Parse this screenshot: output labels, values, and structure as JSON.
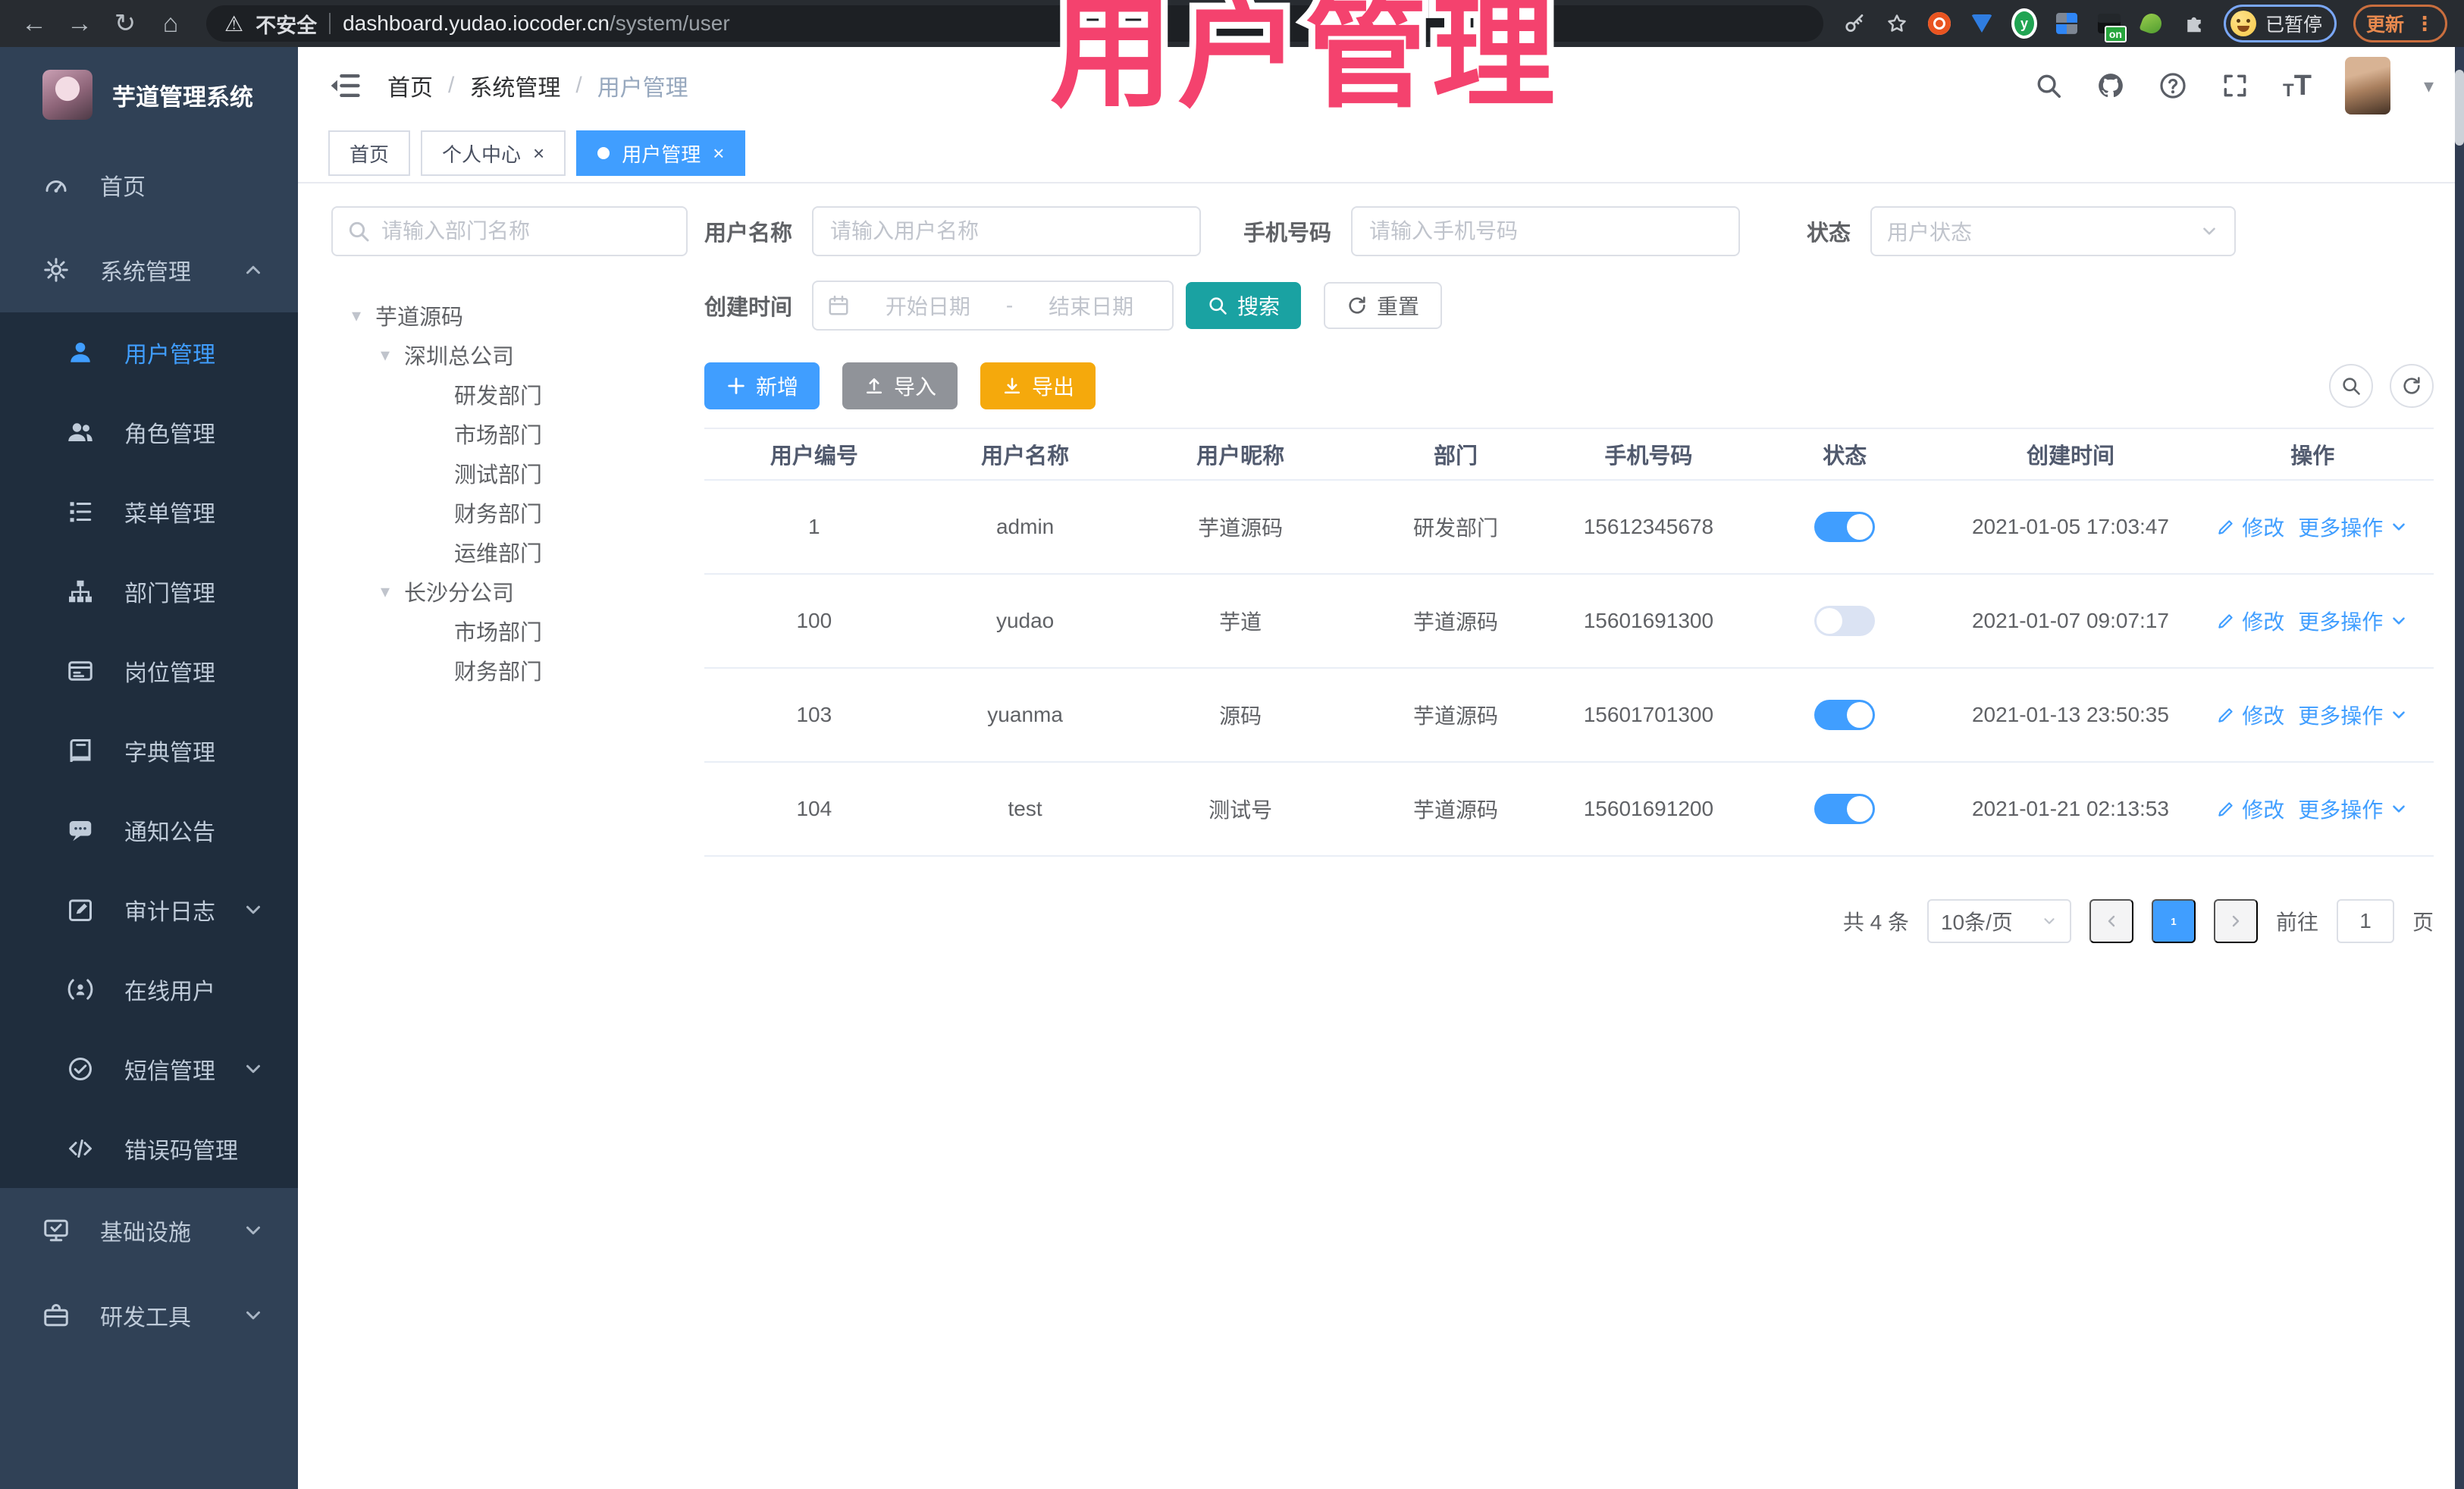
{
  "browser": {
    "security_label": "不安全",
    "url_host": "dashboard.yudao.iocoder.cn",
    "url_path": "/system/user",
    "profile_status": "已暂停",
    "update_label": "更新",
    "extension_badge": "on"
  },
  "overlay_title": "用户管理",
  "icons": {
    "close": "×",
    "caret_down": "▾",
    "dots_vertical": "⋮",
    "back": "←",
    "forward": "→",
    "reload": "↻",
    "home": "⌂",
    "warning": "⚠",
    "tree_caret": "▾"
  },
  "sidebar": {
    "title": "芋道管理系统",
    "items": [
      {
        "icon": "gauge",
        "label": "首页",
        "level": 1
      },
      {
        "icon": "gear",
        "label": "系统管理",
        "level": 1,
        "chevron": "up"
      },
      {
        "icon": "user",
        "label": "用户管理",
        "level": 2,
        "active": true
      },
      {
        "icon": "users",
        "label": "角色管理",
        "level": 2
      },
      {
        "icon": "list",
        "label": "菜单管理",
        "level": 2
      },
      {
        "icon": "tree",
        "label": "部门管理",
        "level": 2
      },
      {
        "icon": "idcard",
        "label": "岗位管理",
        "level": 2
      },
      {
        "icon": "book",
        "label": "字典管理",
        "level": 2
      },
      {
        "icon": "chat",
        "label": "通知公告",
        "level": 2
      },
      {
        "icon": "editpad",
        "label": "审计日志",
        "level": 2,
        "chevron": "down"
      },
      {
        "icon": "online",
        "label": "在线用户",
        "level": 2
      },
      {
        "icon": "checkcircle",
        "label": "短信管理",
        "level": 2,
        "chevron": "down"
      },
      {
        "icon": "code",
        "label": "错误码管理",
        "level": 2
      },
      {
        "icon": "monitor",
        "label": "基础设施",
        "level": 1,
        "chevron": "down"
      },
      {
        "icon": "toolbox",
        "label": "研发工具",
        "level": 1,
        "chevron": "down"
      }
    ]
  },
  "header": {
    "breadcrumb": [
      "首页",
      "系统管理",
      "用户管理"
    ]
  },
  "tabs": [
    {
      "label": "首页",
      "closable": false,
      "active": false
    },
    {
      "label": "个人中心",
      "closable": true,
      "active": false
    },
    {
      "label": "用户管理",
      "closable": true,
      "active": true
    }
  ],
  "dept": {
    "search_placeholder": "请输入部门名称",
    "tree": [
      {
        "label": "芋道源码",
        "depth": 0,
        "caret": true
      },
      {
        "label": "深圳总公司",
        "depth": 1,
        "caret": true
      },
      {
        "label": "研发部门",
        "depth": 2
      },
      {
        "label": "市场部门",
        "depth": 2
      },
      {
        "label": "测试部门",
        "depth": 2
      },
      {
        "label": "财务部门",
        "depth": 2
      },
      {
        "label": "运维部门",
        "depth": 2
      },
      {
        "label": "长沙分公司",
        "depth": 1,
        "caret": true
      },
      {
        "label": "市场部门",
        "depth": 2
      },
      {
        "label": "财务部门",
        "depth": 2
      }
    ]
  },
  "filter": {
    "username_label": "用户名称",
    "username_placeholder": "请输入用户名称",
    "mobile_label": "手机号码",
    "mobile_placeholder": "请输入手机号码",
    "status_label": "状态",
    "status_placeholder": "用户状态",
    "created_label": "创建时间",
    "date_start": "开始日期",
    "date_sep": "-",
    "date_end": "结束日期",
    "search_label": "搜索",
    "reset_label": "重置"
  },
  "toolbar": {
    "add_label": "新增",
    "import_label": "导入",
    "export_label": "导出"
  },
  "table": {
    "columns": [
      "用户编号",
      "用户名称",
      "用户昵称",
      "部门",
      "手机号码",
      "状态",
      "创建时间",
      "操作"
    ],
    "actions": {
      "edit": "修改",
      "more": "更多操作"
    },
    "rows": [
      {
        "id": "1",
        "username": "admin",
        "nickname": "芋道源码",
        "dept": "研发部门",
        "mobile": "15612345678",
        "status": true,
        "created": "2021-01-05 17:03:47"
      },
      {
        "id": "100",
        "username": "yudao",
        "nickname": "芋道",
        "dept": "芋道源码",
        "mobile": "15601691300",
        "status": false,
        "created": "2021-01-07 09:07:17"
      },
      {
        "id": "103",
        "username": "yuanma",
        "nickname": "源码",
        "dept": "芋道源码",
        "mobile": "15601701300",
        "status": true,
        "created": "2021-01-13 23:50:35"
      },
      {
        "id": "104",
        "username": "test",
        "nickname": "测试号",
        "dept": "芋道源码",
        "mobile": "15601691200",
        "status": true,
        "created": "2021-01-21 02:13:53"
      }
    ]
  },
  "pagination": {
    "total": "共 4 条",
    "page_size": "10条/页",
    "current": "1",
    "goto_label": "前往",
    "goto_value": "1",
    "unit_label": "页"
  },
  "colors": {
    "accent": "#409EFF",
    "teal": "#1AA2A2",
    "warning": "#F5A90C",
    "info": "#909399",
    "pink": "#F4426E",
    "sidebar_bg": "#304156",
    "submenu_bg": "#1F2D3D"
  }
}
